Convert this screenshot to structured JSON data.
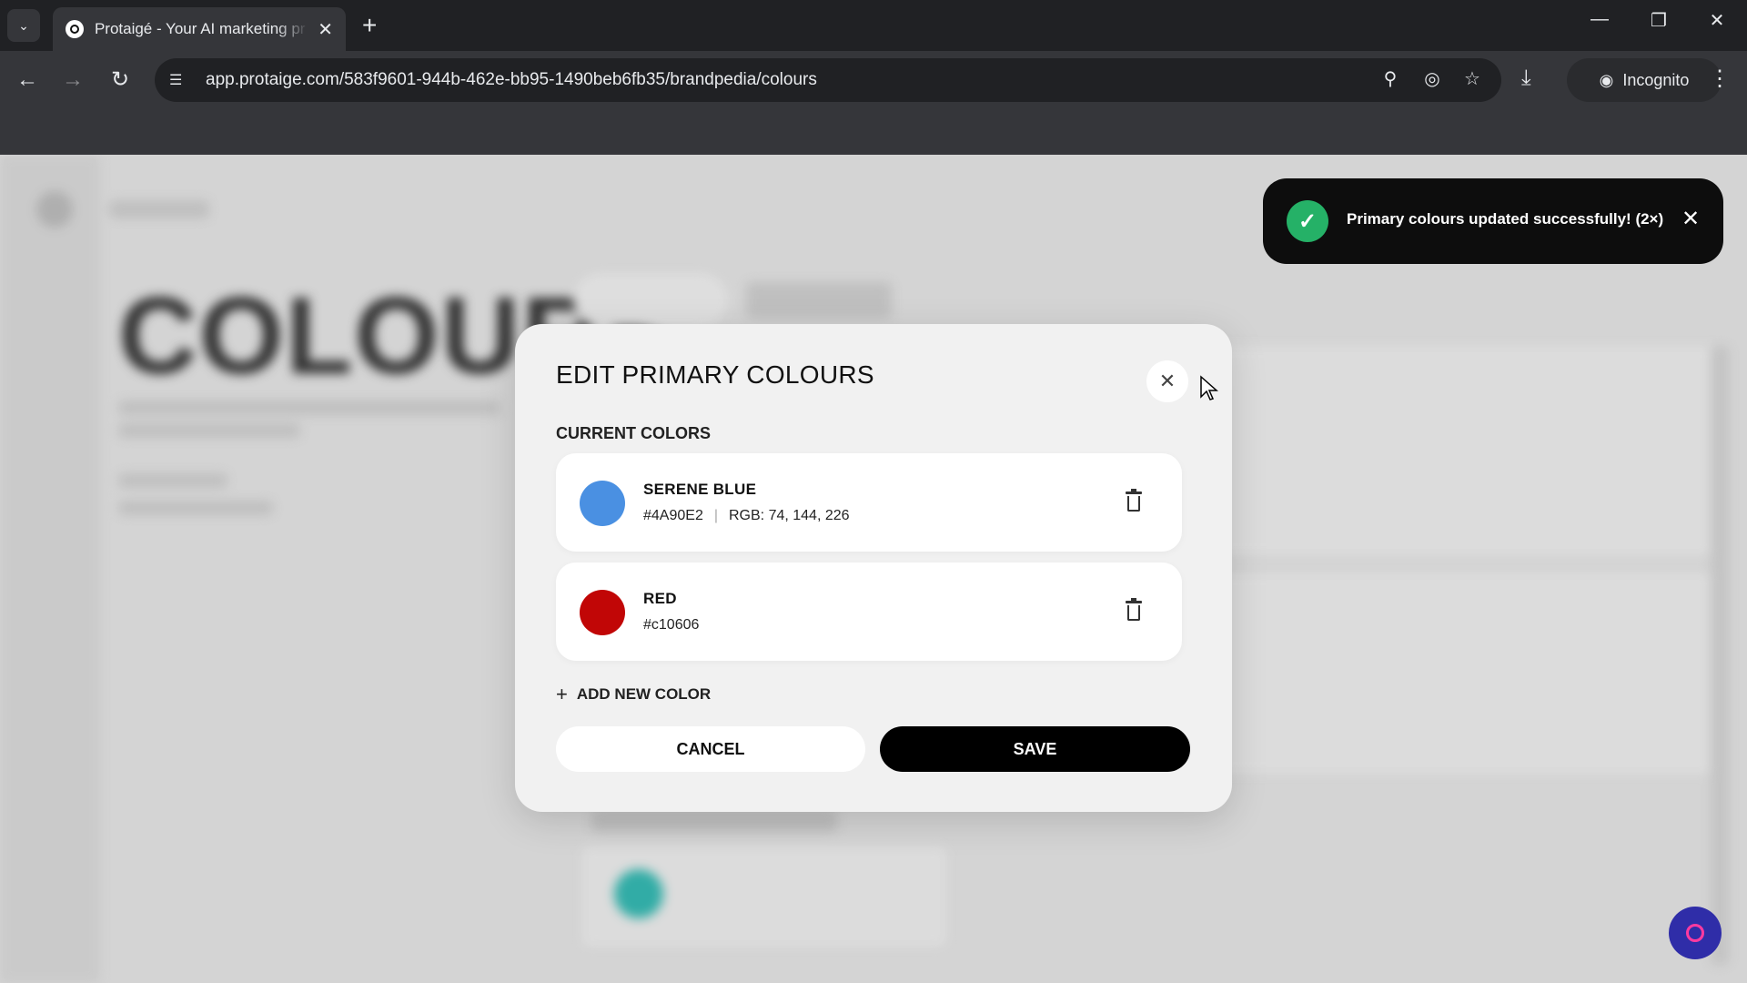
{
  "browser": {
    "tab_title": "Protaigé - Your AI marketing pr",
    "url": "app.protaige.com/583f9601-944b-462e-bb95-1490beb6fb35/brandpedia/colours",
    "incognito_label": "Incognito"
  },
  "background": {
    "page_heading": "COLOURS"
  },
  "toast": {
    "message": "Primary colours updated successfully! (2×)"
  },
  "modal": {
    "title": "EDIT PRIMARY COLOURS",
    "section_label": "CURRENT COLORS",
    "colors": [
      {
        "name": "SERENE BLUE",
        "hex": "#4A90E2",
        "rgb": "RGB: 74, 144, 226",
        "swatch": "#4A90E2"
      },
      {
        "name": "RED",
        "hex": "#c10606",
        "swatch": "#c10606"
      }
    ],
    "add_label": "ADD NEW COLOR",
    "cancel_label": "CANCEL",
    "save_label": "SAVE"
  },
  "icons": {
    "tab_list": "chevron-down-icon",
    "favicon": "protaige-logo-icon",
    "back": "arrow-left-icon",
    "forward": "arrow-right-icon",
    "reload": "reload-icon",
    "site_info": "tune-icon",
    "zoom": "magnifier-icon",
    "eye_off": "eye-off-icon",
    "star": "star-icon",
    "download": "download-icon",
    "menu": "kebab-menu-icon",
    "trash": "trash-icon",
    "check": "check-icon"
  },
  "colors": {
    "toast_success": "#25b167",
    "primary_button": "#000000",
    "fab": "#2f2da8"
  }
}
